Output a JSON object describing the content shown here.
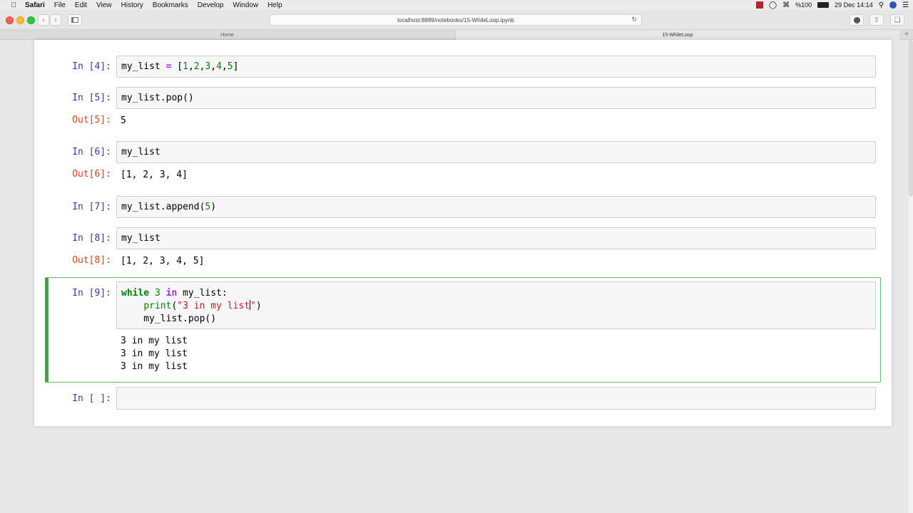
{
  "menubar": {
    "app": "Safari",
    "items": [
      "File",
      "Edit",
      "View",
      "History",
      "Bookmarks",
      "Develop",
      "Window",
      "Help"
    ],
    "battery": "%100",
    "datetime": "29 Dec 14:14"
  },
  "browser": {
    "url": "localhost:8889/notebooks/15-WhileLoop.ipynb",
    "tabs": [
      {
        "label": "Home",
        "active": false
      },
      {
        "label": "15-WhileLoop",
        "active": true
      }
    ]
  },
  "cells": [
    {
      "in_prompt": "In [4]:",
      "code": "my_list = [1,2,3,4,5]"
    },
    {
      "in_prompt": "In [5]:",
      "code": "my_list.pop()",
      "out_prompt": "Out[5]:",
      "output": "5"
    },
    {
      "in_prompt": "In [6]:",
      "code": "my_list",
      "out_prompt": "Out[6]:",
      "output": "[1, 2, 3, 4]"
    },
    {
      "in_prompt": "In [7]:",
      "code": "my_list.append(5)"
    },
    {
      "in_prompt": "In [8]:",
      "code": "my_list",
      "out_prompt": "Out[8]:",
      "output": "[1, 2, 3, 4, 5]"
    },
    {
      "in_prompt": "In [9]:",
      "code_lines": {
        "l1_kw": "while",
        "l1_num": "3",
        "l1_op": "in",
        "l1_rest": "my_list:",
        "l2_indent": "    ",
        "l2_fn": "print",
        "l2_paren_open": "(",
        "l2_str_a": "\"3 in my list",
        "l2_str_b": "\"",
        "l2_paren_close": ")",
        "l3": "    my_list.pop()"
      },
      "stdout": [
        "3 in my list",
        "3 in my list",
        "3 in my list"
      ]
    },
    {
      "in_prompt": "In [ ]:",
      "code": ""
    }
  ],
  "colors": {
    "in_prompt": "#303f9f",
    "out_prompt": "#d84315",
    "selected_border": "#42a548",
    "keyword": "#008000",
    "string": "#ba2121"
  }
}
